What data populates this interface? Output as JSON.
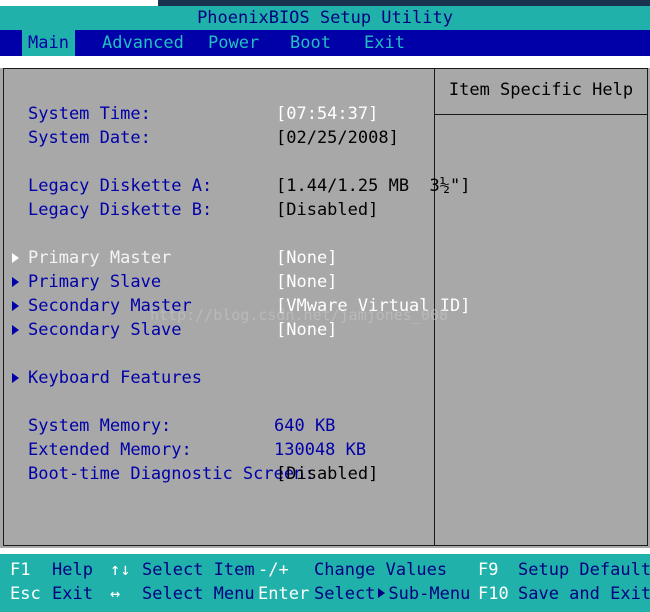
{
  "title": "PhoenixBIOS Setup Utility",
  "menu": [
    {
      "label": "Main",
      "active": true
    },
    {
      "label": "Advanced",
      "active": false
    },
    {
      "label": "Power",
      "active": false
    },
    {
      "label": "Boot",
      "active": false
    },
    {
      "label": "Exit",
      "active": false
    }
  ],
  "help": {
    "title": "Item Specific Help"
  },
  "fields": {
    "system_time": {
      "label": "System Time:",
      "value": "[07:54:37]"
    },
    "system_date": {
      "label": "System Date:",
      "value": "[02/25/2008]"
    },
    "diskette_a": {
      "label": "Legacy Diskette A:",
      "value": "[1.44/1.25 MB  3½\"]"
    },
    "diskette_b": {
      "label": "Legacy Diskette B:",
      "value": "[Disabled]"
    },
    "primary_master": {
      "label": "Primary Master",
      "value": "[None]"
    },
    "primary_slave": {
      "label": "Primary Slave",
      "value": "[None]"
    },
    "secondary_master": {
      "label": "Secondary Master",
      "value": "[VMware Virtual ID]"
    },
    "secondary_slave": {
      "label": "Secondary Slave",
      "value": "[None]"
    },
    "keyboard_features": {
      "label": "Keyboard Features"
    },
    "system_memory": {
      "label": "System Memory:",
      "value": "640 KB"
    },
    "extended_memory": {
      "label": "Extended Memory:",
      "value": "130048 KB"
    },
    "boot_diag": {
      "label": "Boot-time Diagnostic Screen:",
      "value": "[Disabled]"
    }
  },
  "watermark": "http://blog.csdn.net/jamjones_008",
  "footer": {
    "row1": {
      "k1": "F1",
      "d1": "Help",
      "k2": "↑↓",
      "d2": "Select Item",
      "k3": "-/+",
      "d3": "Change Values",
      "k4": "F9",
      "d4": "Setup Defaults"
    },
    "row2": {
      "k1": "Esc",
      "d1": "Exit",
      "k2": "↔",
      "d2": "Select Menu",
      "k3": "Enter",
      "d3a": "Select",
      "d3b": "Sub-Menu",
      "k4": "F10",
      "d4": "Save and Exit"
    }
  },
  "colors": {
    "teal": "#20b2aa",
    "menu_blue": "#0000a8",
    "panel_gray": "#a8a8a8",
    "label_blue": "#0000a8",
    "highlight_white": "#ffffff"
  }
}
